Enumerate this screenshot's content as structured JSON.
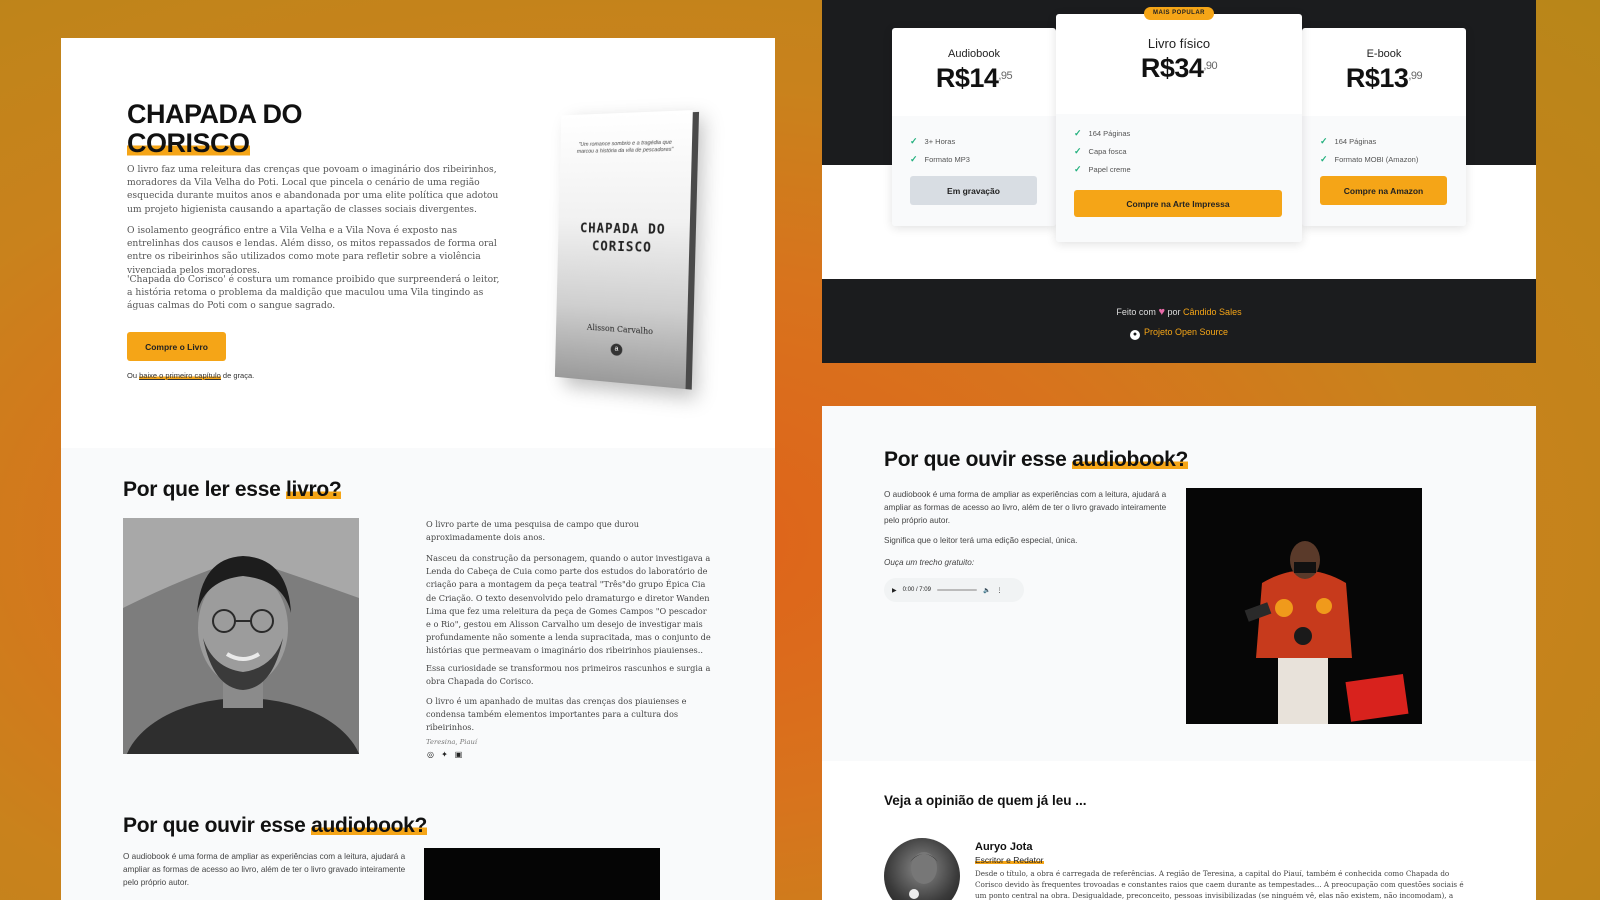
{
  "hero": {
    "title_line1": "CHAPADA DO",
    "title_line2": "CORISCO",
    "paragraphs": [
      "O livro faz uma releitura das crenças que povoam o imaginário dos ribeirinhos, moradores da Vila Velha do Poti. Local que pincela o cenário de uma região esquecida durante muitos anos e abandonada por uma elite política que adotou um projeto higienista causando a apartação de classes sociais divergentes.",
      "O isolamento geográfico entre a Vila Velha e a Vila Nova é exposto nas entrelinhas dos causos e lendas. Além disso, os mitos repassados de forma oral entre os ribeirinhos são utilizados como mote para refletir sobre a violência vivenciada pelos moradores.",
      "'Chapada do Corisco' é costura um romance proibido que surpreenderá o leitor, a história retoma o problema da maldição que maculou uma Vila tingindo as águas calmas do Poti com o sangue sagrado."
    ],
    "buy_button": "Compre o Livro",
    "free_prefix": "Ou",
    "free_link": "baixe o primeiro capítulo",
    "free_suffix": "de graça."
  },
  "book_cover": {
    "tagline": "\"Um romance sombrio e a tragédia que marcou a história da vila de pescadores\"",
    "title_line1": "CHAPADA DO",
    "title_line2": "CORISCO",
    "author": "Alisson Carvalho",
    "logo": "a"
  },
  "why_read": {
    "title_prefix": "Por que ler esse",
    "title_highlight": "livro?",
    "paragraphs": [
      "O livro parte de uma pesquisa de campo que durou aproximadamente dois anos.",
      "Nasceu da construção da personagem, quando o autor investigava a Lenda do Cabeça de Cuia como parte dos estudos do laboratório de criação para a montagem da peça teatral \"Três\"do grupo Épica Cia de Criação. O texto desenvolvido pelo dramaturgo e diretor Wanden Lima que fez uma releitura da peça de Gomes Campos \"O pescador e o Rio\", gestou em Alisson Carvalho um desejo de investigar mais profundamente não somente a lenda supracitada, mas o conjunto de histórias que permeavam o imaginário dos ribeirinhos piauienses..",
      "Essa curiosidade se transformou nos primeiros rascunhos e surgia a obra Chapada do Corisco.",
      "O livro é um apanhado de muitas das crenças dos piauienses e condensa também elementos importantes para a cultura dos ribeirinhos."
    ],
    "location": "Teresina, Piauí",
    "social_icons": [
      "instagram-icon",
      "twitter-icon",
      "linkedin-icon"
    ]
  },
  "audiobook": {
    "title_prefix": "Por que ouvir esse",
    "title_highlight": "audiobook?",
    "paragraph1": "O audiobook é uma forma de ampliar as experiências com a leitura, ajudará a ampliar as formas de acesso ao livro, além de ter o livro gravado inteiramente pelo próprio autor.",
    "paragraph2": "Significa que o leitor terá uma edição especial, única.",
    "sample_label": "Ouça um trecho gratuito:",
    "player_time": "0:00 / 7:09"
  },
  "pricing": {
    "popular_badge": "MAIS POPULAR",
    "plans": [
      {
        "name": "Audiobook",
        "price": "R$14",
        "cents": ",95",
        "features": [
          "3+ Horas",
          "Formato MP3"
        ],
        "button": "Em gravação"
      },
      {
        "name": "Livro físico",
        "price": "R$34",
        "cents": ",90",
        "features": [
          "164 Páginas",
          "Capa fosca",
          "Papel creme"
        ],
        "button": "Compre na Arte Impressa"
      },
      {
        "name": "E-book",
        "price": "R$13",
        "cents": ",99",
        "features": [
          "164 Páginas",
          "Formato MOBI (Amazon)"
        ],
        "button": "Compre na Amazon"
      }
    ]
  },
  "footer": {
    "made_with": "Feito com",
    "by": "por",
    "author": "Cândido Sales",
    "open_source": "Projeto Open Source"
  },
  "reviews": {
    "title": "Veja a opinião de quem já leu ...",
    "reviewer_name": "Auryo Jota",
    "reviewer_role": "Escritor e Redator",
    "text": "Desde o título, a obra é carregada de referências. A região de Teresina, a capital do Piauí, também é conhecida como Chapada do Corisco devido às frequentes trovoadas e constantes raios que caem durante as tempestades... A preocupação com questões sociais é um ponto central na obra. Desigualdade, preconceito, pessoas invisibilizadas (se ninguém vê, elas não existem, não incomodam), a normalização da violência sofrida por"
  },
  "colors": {
    "accent": "#f5a517",
    "dark": "#1b1c1e",
    "check": "#22b07d",
    "disabled_button": "#d8dde3"
  }
}
